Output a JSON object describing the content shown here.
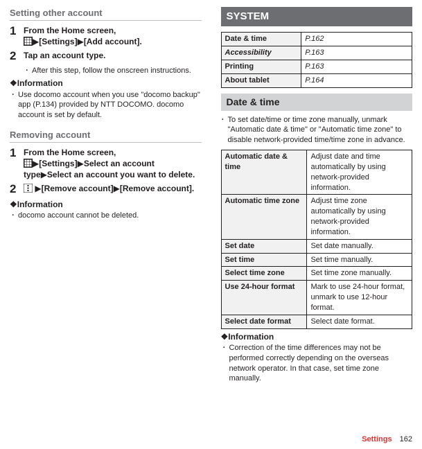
{
  "left": {
    "settingOtherTitle": "Setting other account",
    "step1num": "1",
    "step1title_a": "From the Home screen,",
    "step1title_b": "[Settings]",
    "step1title_c": "[Add account].",
    "step2num": "2",
    "step2title": "Tap an account type.",
    "step2bullet": "After this step, follow the onscreen instructions.",
    "infoHead": "❖Information",
    "infoBullet1": "Use docomo account when you use \"docomo backup\" app (P.134) provided by NTT DOCOMO. docomo account is set by default.",
    "removingTitle": "Removing account",
    "rstep1num": "1",
    "rstep1title_a": "From the Home screen,",
    "rstep1title_b": "[Settings]",
    "rstep1title_c": "Select an account type",
    "rstep1title_d": "Select an account you want to delete.",
    "rstep2num": "2",
    "rstep2title_a": "[Remove account]",
    "rstep2title_b": "[Remove account].",
    "infoBullet2": "docomo account cannot be deleted."
  },
  "right": {
    "systemBanner": "SYSTEM",
    "sysTable": [
      {
        "k": "Date & time",
        "v": "P.162"
      },
      {
        "k": "Accessibility",
        "v": "P.163"
      },
      {
        "k": "Printing",
        "v": "P.163"
      },
      {
        "k": "About tablet",
        "v": "P.164"
      }
    ],
    "dateTimeBanner": "Date & time",
    "dateTimeIntro": "To set date/time or time zone manually, unmark \"Automatic date & time\" or \"Automatic time zone\" to disable network-provided time/time zone in advance.",
    "settingsTable": [
      {
        "k": "Automatic date & time",
        "v": "Adjust date and time automatically by using network-provided information."
      },
      {
        "k": "Automatic time zone",
        "v": "Adjust time zone automatically by using network-provided information."
      },
      {
        "k": "Set date",
        "v": "Set date manually."
      },
      {
        "k": "Set time",
        "v": "Set time manually."
      },
      {
        "k": "Select time zone",
        "v": "Set time zone manually."
      },
      {
        "k": "Use 24-hour format",
        "v": "Mark to use 24-hour format, unmark to use 12-hour format."
      },
      {
        "k": "Select date format",
        "v": "Select date format."
      }
    ],
    "infoHead": "❖Information",
    "infoBullet": "Correction of the time differences may not be performed correctly depending on the overseas network operator. In that case, set time zone manually."
  },
  "footer": {
    "label": "Settings",
    "page": "162"
  },
  "glyphs": {
    "tri": "▶",
    "dot": "･"
  }
}
